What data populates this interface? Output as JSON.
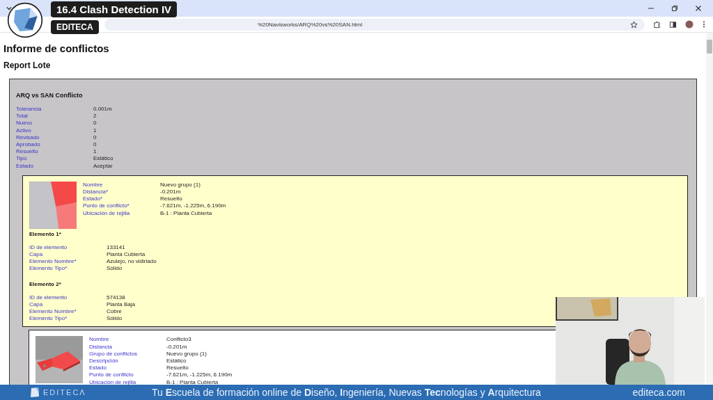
{
  "browser": {
    "url": "%20Navisworks/ARQ%20vs%20SAN.html"
  },
  "overlay": {
    "title": "16.4 Clash Detection IV",
    "brand": "EDITECA"
  },
  "page": {
    "heading": "Informe de conflictos",
    "subheading": "Report Lote"
  },
  "test": {
    "title": "ARQ vs SAN Conflicto",
    "fields": [
      {
        "label": "Tolerancia",
        "value": "0.001m"
      },
      {
        "label": "Total",
        "value": "2"
      },
      {
        "label": "Nuevo",
        "value": "0"
      },
      {
        "label": "Activo",
        "value": "1"
      },
      {
        "label": "Revisado",
        "value": "0"
      },
      {
        "label": "Aprobado",
        "value": "0"
      },
      {
        "label": "Resuelto",
        "value": "1"
      },
      {
        "label": "Tipo",
        "value": "Estático"
      },
      {
        "label": "Estado",
        "value": "Aceptar"
      }
    ]
  },
  "clashes": [
    {
      "highlighted": true,
      "fields": [
        {
          "label": "Nombre",
          "value": "Nuevo grupo (1)"
        },
        {
          "label": "Distancia*",
          "value": "-0.201m"
        },
        {
          "label": "Estado*",
          "value": "Resuelto"
        },
        {
          "label": "Punto de conflicto*",
          "value": "-7.621m,  -1.225m,  6.190m"
        },
        {
          "label": "Ubicación de rejilla",
          "value": "B-1 : Planta Cubierta"
        }
      ],
      "elements": [
        {
          "title": "Elemento 1*",
          "fields": [
            {
              "label": "ID de elemento",
              "value": "133141"
            },
            {
              "label": "Capa",
              "value": "Planta Cubierta"
            },
            {
              "label": "Elemento Nombre*",
              "value": "Azulejo, no vidiriado"
            },
            {
              "label": "Elemento Tipo*",
              "value": "Sólido"
            }
          ]
        },
        {
          "title": "Elemento 2*",
          "fields": [
            {
              "label": "ID de elemento",
              "value": "574138"
            },
            {
              "label": "Capa",
              "value": "Planta Baja"
            },
            {
              "label": "Elemento Nombre*",
              "value": "Cobre"
            },
            {
              "label": "Elemento Tipo*",
              "value": "Sólido"
            }
          ]
        }
      ]
    },
    {
      "highlighted": false,
      "fields": [
        {
          "label": "Nombre",
          "value": "Conflicto3"
        },
        {
          "label": "Distancia",
          "value": "-0.201m"
        },
        {
          "label": "Grupo de conflictos",
          "value": "Nuevo grupo (1)"
        },
        {
          "label": "Descripción",
          "value": "Estático"
        },
        {
          "label": "Estado",
          "value": "Resuelto"
        },
        {
          "label": "Punto de conflicto",
          "value": "-7.621m,  -1.225m,  6.190m"
        },
        {
          "label": "Ubicación de rejilla",
          "value": "B-1 : Planta Cubierta"
        }
      ]
    }
  ],
  "footer": {
    "logo": "EDITECΛ",
    "slogan": "Tu **E**scuela de formación online de **D**iseño, **I**ngeniería, Nuevas **Tec**nologías y **A**rquitectura",
    "site": "editeca.com"
  }
}
